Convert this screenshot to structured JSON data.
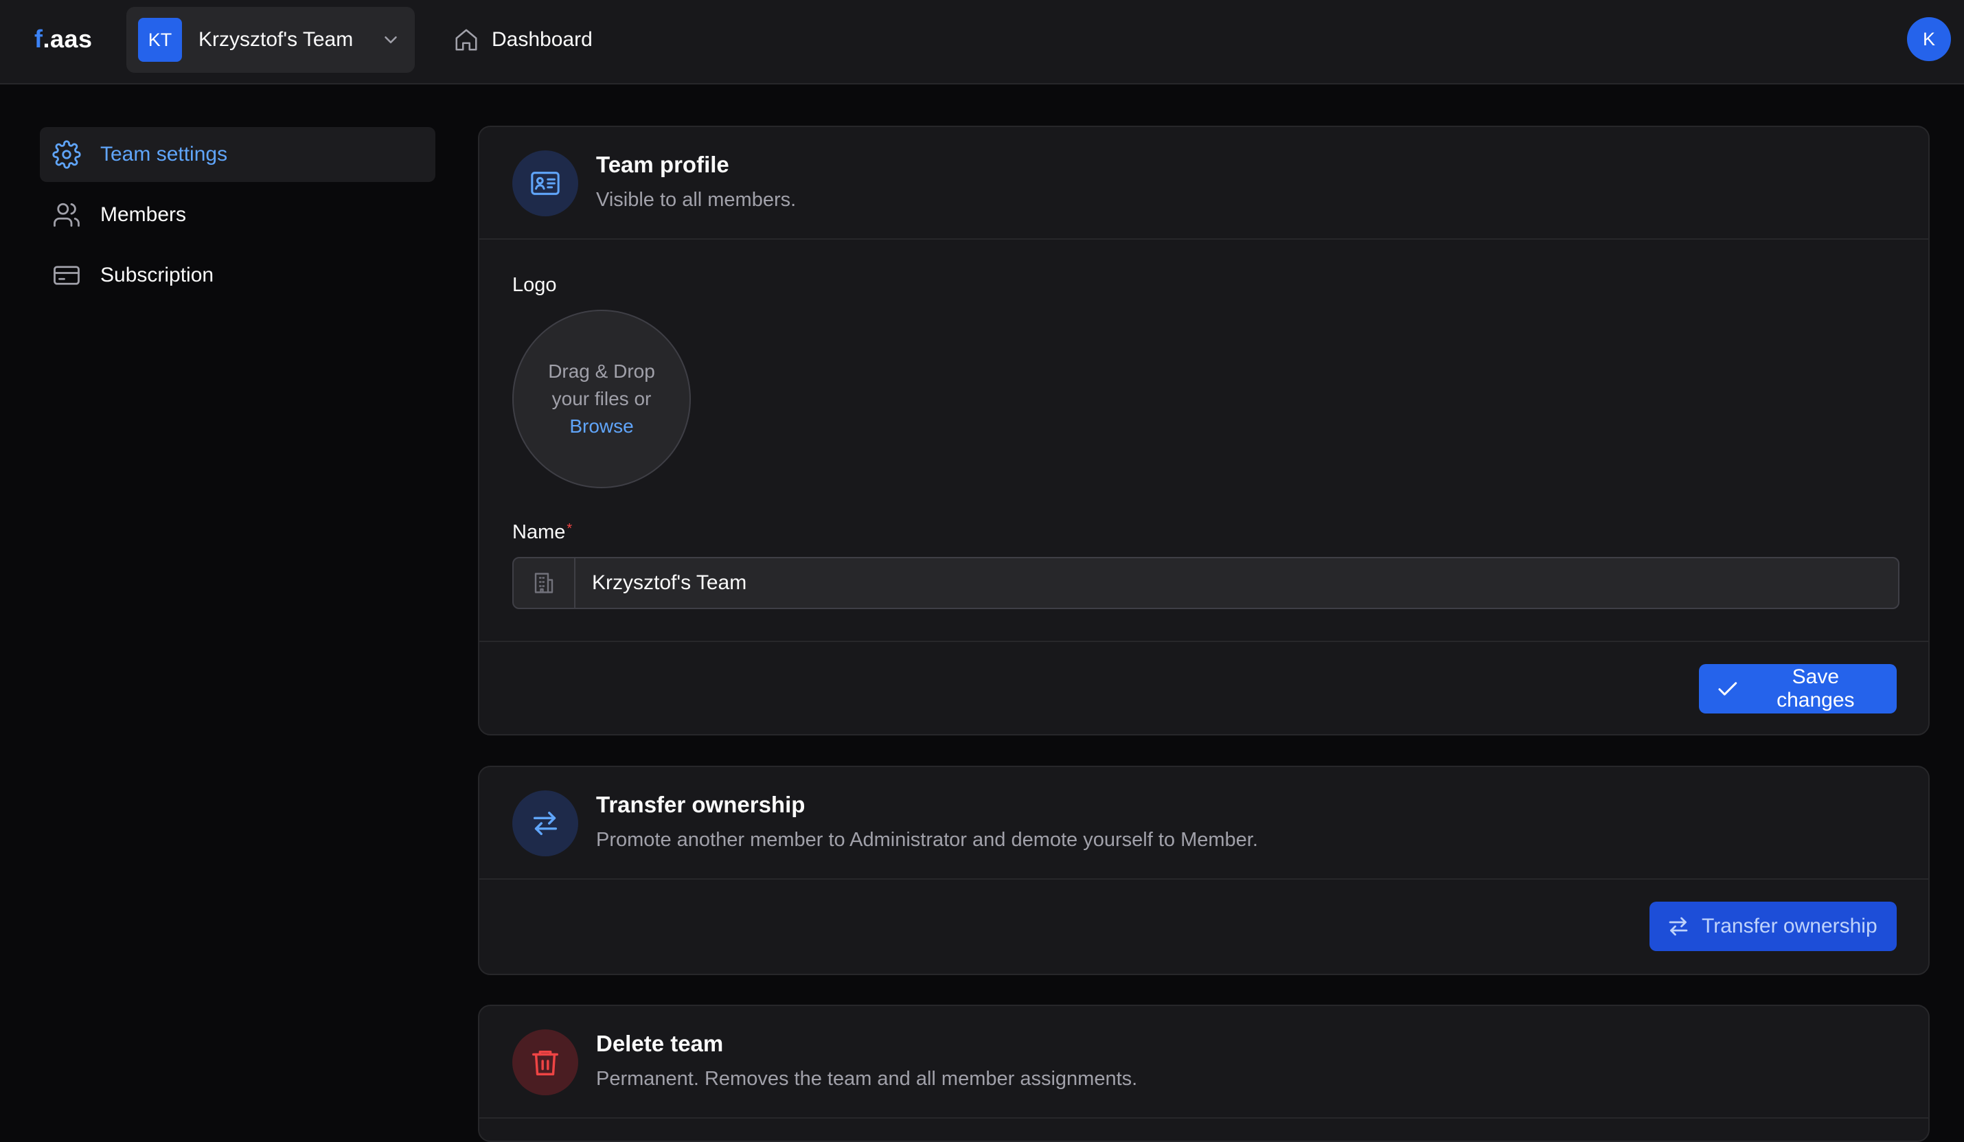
{
  "header": {
    "brand_prefix": "f",
    "brand_suffix": ".aas",
    "team_initials": "KT",
    "team_name": "Krzysztof's Team",
    "dashboard_label": "Dashboard",
    "user_initial": "K"
  },
  "sidebar": {
    "items": [
      {
        "label": "Team settings",
        "icon": "gear-icon",
        "active": true
      },
      {
        "label": "Members",
        "icon": "users-icon",
        "active": false
      },
      {
        "label": "Subscription",
        "icon": "credit-card-icon",
        "active": false
      }
    ]
  },
  "team_profile": {
    "title": "Team profile",
    "subtitle": "Visible to all members.",
    "logo_label": "Logo",
    "dropzone_text": "Drag & Drop your files or",
    "browse_label": "Browse",
    "name_label": "Name",
    "required_mark": "*",
    "name_value": "Krzysztof's Team",
    "save_label": "Save changes"
  },
  "transfer": {
    "title": "Transfer ownership",
    "subtitle": "Promote another member to Administrator and demote yourself to Member.",
    "button_label": "Transfer ownership"
  },
  "delete_team": {
    "title": "Delete team",
    "subtitle": "Permanent. Removes the team and all member assignments."
  },
  "colors": {
    "accent": "#2563eb",
    "accent_text": "#60a5fa",
    "danger": "#ef4444",
    "background": "#09090b",
    "surface": "#18181b"
  }
}
